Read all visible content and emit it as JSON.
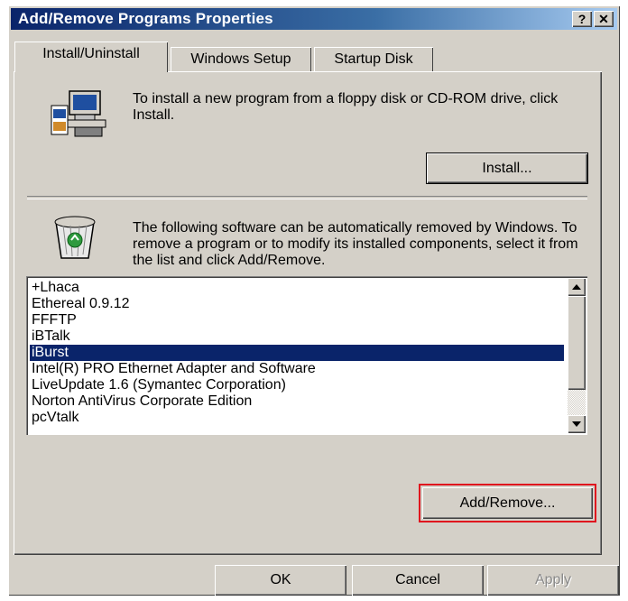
{
  "window": {
    "title": "Add/Remove Programs Properties",
    "help_button": "?",
    "close_button": "✕"
  },
  "tabs": [
    {
      "label": "Install/Uninstall",
      "active": true
    },
    {
      "label": "Windows Setup",
      "active": false
    },
    {
      "label": "Startup Disk",
      "active": false
    }
  ],
  "install_section": {
    "icon": "computer-install-icon",
    "text": "To install a new program from a floppy disk or CD-ROM drive, click Install.",
    "install_button": "Install..."
  },
  "remove_section": {
    "icon": "recycle-bin-icon",
    "text": "The following software can be automatically removed by Windows. To remove a program or to modify its installed components, select it from the list and click Add/Remove.",
    "items": [
      "+Lhaca",
      "Ethereal 0.9.12",
      "FFFTP",
      "iBTalk",
      "iBurst",
      "Intel(R) PRO Ethernet Adapter and Software",
      "LiveUpdate 1.6 (Symantec Corporation)",
      "Norton AntiVirus Corporate Edition",
      "pcVtalk"
    ],
    "selected_item": "iBurst",
    "add_remove_button": "Add/Remove..."
  },
  "footer": {
    "ok_label": "OK",
    "cancel_label": "Cancel",
    "apply_label": "Apply"
  },
  "colors": {
    "selection": "#0a246a",
    "highlight_box": "#e0141e",
    "dialog_face": "#d4d0c8"
  }
}
